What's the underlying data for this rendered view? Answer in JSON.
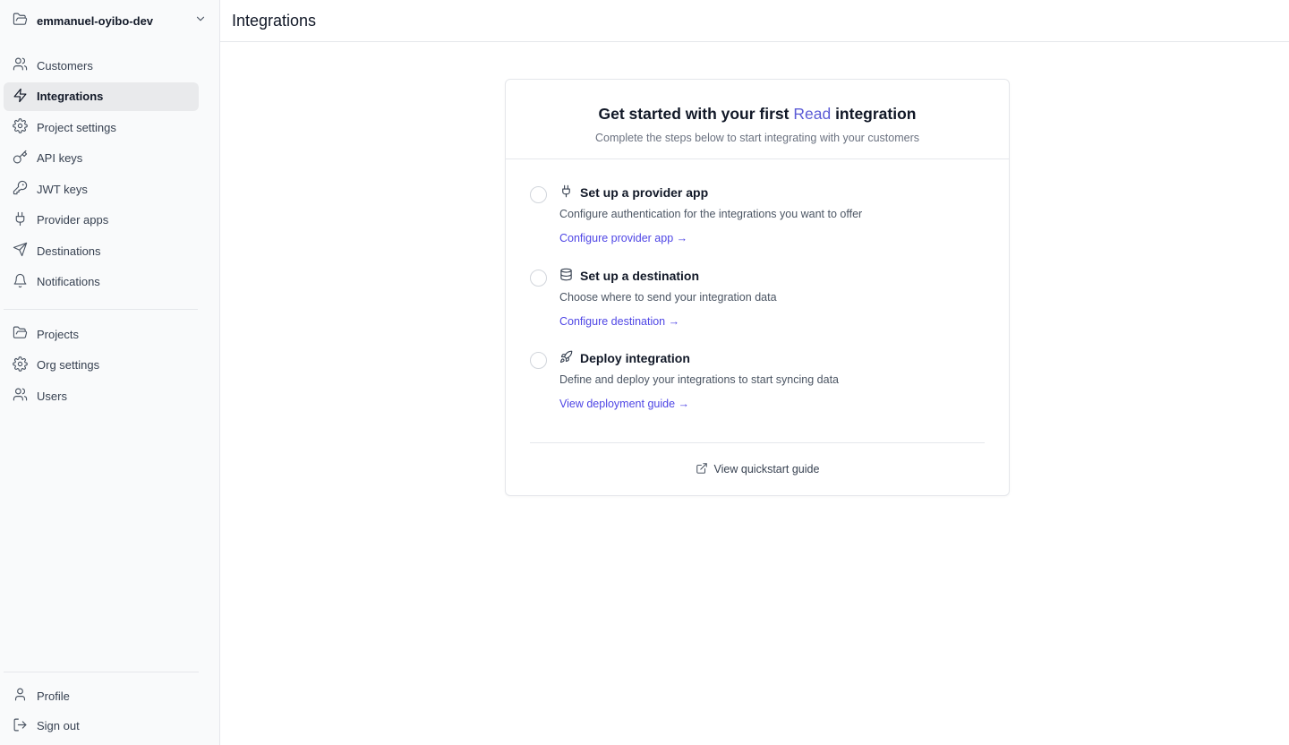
{
  "sidebar": {
    "project_name": "emmanuel-oyibo-dev",
    "items": [
      {
        "label": "Customers",
        "icon": "users-icon"
      },
      {
        "label": "Integrations",
        "icon": "lightning-icon",
        "active": true
      },
      {
        "label": "Project settings",
        "icon": "gear-icon"
      },
      {
        "label": "API keys",
        "icon": "key-icon"
      },
      {
        "label": "JWT keys",
        "icon": "key-round-icon"
      },
      {
        "label": "Provider apps",
        "icon": "plug-icon"
      },
      {
        "label": "Destinations",
        "icon": "send-icon"
      },
      {
        "label": "Notifications",
        "icon": "bell-icon"
      }
    ],
    "org_items": [
      {
        "label": "Projects",
        "icon": "folder-icon"
      },
      {
        "label": "Org settings",
        "icon": "gear-icon"
      },
      {
        "label": "Users",
        "icon": "users-icon"
      }
    ],
    "bottom_items": [
      {
        "label": "Profile",
        "icon": "user-icon"
      },
      {
        "label": "Sign out",
        "icon": "sign-out-icon"
      }
    ]
  },
  "header": {
    "title": "Integrations"
  },
  "card": {
    "title_prefix": "Get started with your first",
    "title_accent": "Read",
    "title_suffix": "integration",
    "subtitle": "Complete the steps below to start integrating with your customers",
    "steps": [
      {
        "title": "Set up a provider app",
        "icon": "plug-icon",
        "description": "Configure authentication for the integrations you want to offer",
        "link": "Configure provider app →",
        "checked": false
      },
      {
        "title": "Set up a destination",
        "icon": "database-icon",
        "description": "Choose where to send your integration data",
        "link": "Configure destination →",
        "checked": false
      },
      {
        "title": "Deploy integration",
        "icon": "rocket-icon",
        "description": "Define and deploy your integrations to start syncing data",
        "link": "View deployment guide →",
        "checked": false
      }
    ],
    "quickstart_label": "View quickstart guide"
  },
  "colors": {
    "accent": "#5b5bd6",
    "link": "#4f46e5",
    "active_nav_bg": "#e9eaec"
  }
}
